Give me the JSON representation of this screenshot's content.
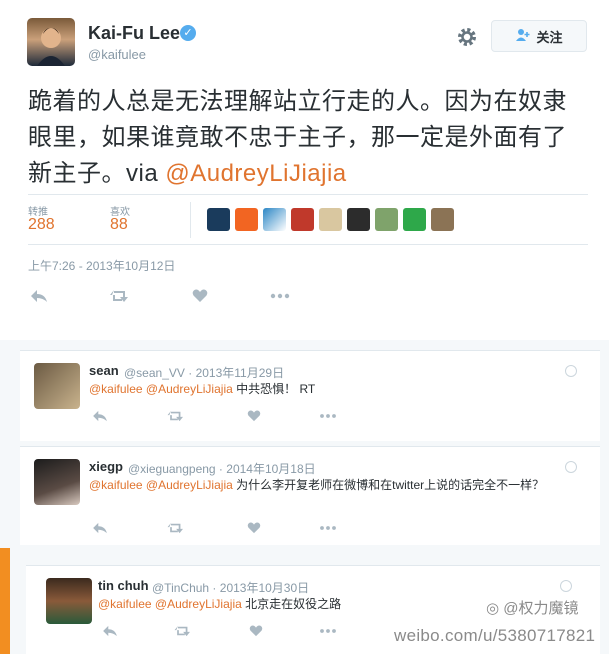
{
  "tweet": {
    "author_name": "Kai-Fu Lee",
    "author_handle": "@kaifulee",
    "follow_label": "关注",
    "text_main": "跪着的人总是无法理解站立行走的人。因为在奴隶眼里，如果谁竟敢不忠于主子，那一定是外面有了新主子。via ",
    "text_mention": "@AudreyLiJiajia",
    "stats": {
      "retweets_label": "转推",
      "retweets_value": "288",
      "likes_label": "喜欢",
      "likes_value": "88"
    },
    "timestamp": "上午7:26 - 2013年10月12日"
  },
  "replies": [
    {
      "name": "sean",
      "handle": "@sean_VV",
      "date": "2013年11月29日",
      "mention1": "@kaifulee",
      "mention2": "@AudreyLiJiajia",
      "text": " 中共恐惧！ RT"
    },
    {
      "name": "xiegp",
      "handle": "@xieguangpeng",
      "date": "2014年10月18日",
      "mention1": "@kaifulee",
      "mention2": "@AudreyLiJiajia",
      "text": " 为什么李开复老师在微博和在twitter上说的话完全不一样？"
    },
    {
      "name": "tin chuh",
      "handle": "@TinChuh",
      "date": "2013年10月30日",
      "mention1": "@kaifulee",
      "mention2": "@AudreyLiJiajia",
      "text": " 北京走在奴役之路"
    }
  ],
  "watermark": {
    "url": "weibo.com/u/5380717821",
    "logo_text": "@权力魔镜"
  },
  "colors": {
    "accent": "#e0742f",
    "muted": "#8899a6",
    "icon": "#aab8c2",
    "highlight_bar": "#f28e21"
  },
  "icons": [
    "gear-icon",
    "follow-person-icon",
    "verified-icon",
    "reply-icon",
    "retweet-icon",
    "like-icon",
    "more-icon",
    "globe-icon"
  ]
}
